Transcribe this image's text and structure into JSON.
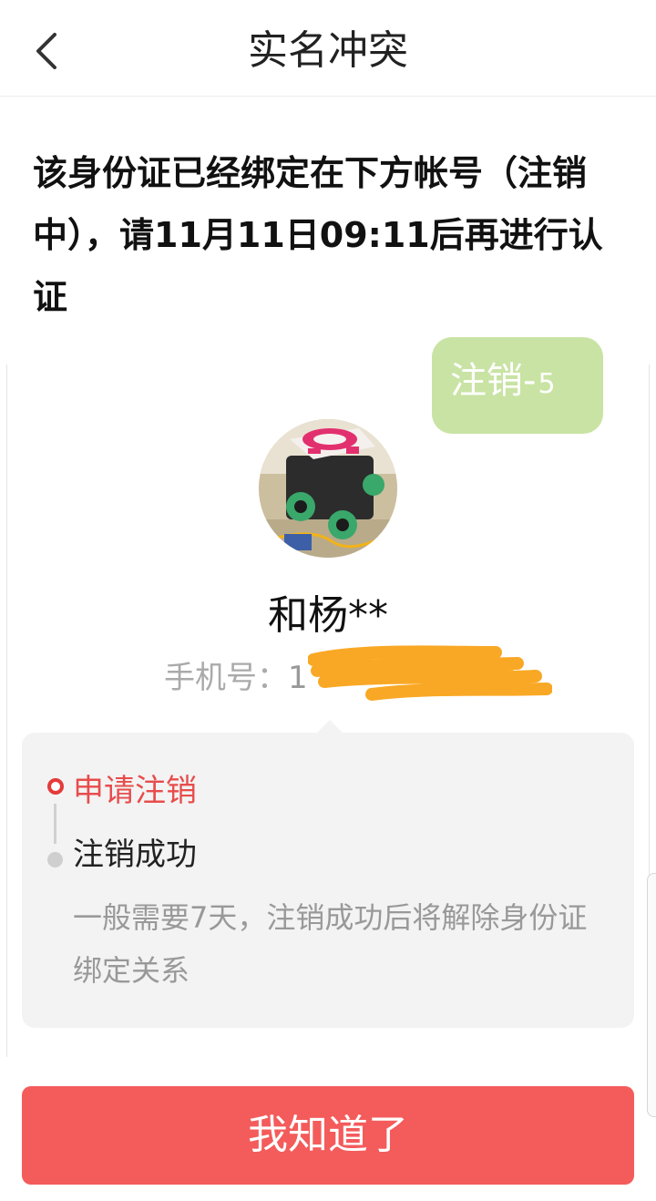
{
  "header": {
    "title": "实名冲突",
    "back_icon": "chevron-left-icon"
  },
  "notice": {
    "text": "该身份证已经绑定在下方帐号（注销中），请11月11日09:11后再进行认证"
  },
  "status_badge": {
    "label": "注销-",
    "count": "5",
    "color": "#c9e3a4"
  },
  "user": {
    "name": "和杨**",
    "phone_label": "手机号：",
    "phone_visible": "1"
  },
  "progress": {
    "steps": [
      {
        "label": "申请注销",
        "state": "active",
        "color": "#e84c4c"
      },
      {
        "label": "注销成功",
        "state": "pending"
      }
    ],
    "description": "一般需要7天，注销成功后将解除身份证绑定关系"
  },
  "button": {
    "label": "我知道了",
    "color": "#f45b5b"
  }
}
